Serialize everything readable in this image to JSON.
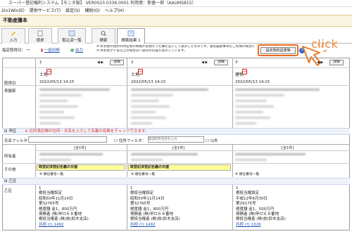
{
  "window": {
    "title": "スーパー登記権利システム【モニタ版】 VER0023.0336.0001 利用者：新香一郎（AAUMS815）"
  },
  "menu": [
    "2in1Win(E)",
    "提供サービス(T)",
    "設定(S)",
    "補助(O)",
    "ヘルプ(H)"
  ],
  "header": {
    "title": "不動産謄本"
  },
  "tabs": [
    {
      "label": "入力"
    },
    {
      "label": "請求"
    },
    {
      "label": "取込済一覧"
    },
    {
      "label": "検索"
    },
    {
      "label": "検索結果 1"
    }
  ],
  "toolbar": {
    "date_label": "指定取得日：",
    "date_sep": "〜",
    "print_link": "一括印刷",
    "export_link": "出力",
    "note1": "※ 所有者の住所の所在地の情報が必要だった欄を記入して請求したものです。通常履歴事項をご利用の場合に目印として使用されるものです。",
    "note2": "※ 共有者が５名以上の場合は一部分の内容を表示しています。",
    "settings_button": "設定契約証書等",
    "help_icon": "?"
  },
  "annotation": {
    "text": "click"
  },
  "columns": [
    {
      "num": "1",
      "detail": "詳細",
      "type": "土地",
      "date": "2022/05/13 14:15"
    },
    {
      "num": "2",
      "detail": "詳細",
      "type": "土地",
      "date": "2022/05/13 14:15"
    },
    {
      "num": "3",
      "detail": "詳細",
      "type": "建物",
      "date": "2022/05/13 14:15"
    }
  ],
  "rows": {
    "acquired": "取得日",
    "header_section": "表題部",
    "a_section": "甲区",
    "b_section": "乙区",
    "owner": "所有者",
    "other": "その他"
  },
  "kouku": {
    "note": "※ 住所表記欄の住所・氏名を入力して名義の有無をチェックできます。",
    "name_filter": "氏名フィルタ：",
    "addr_filter": "住所フィルタ：",
    "addr_placeholder": "都道府県名等を入力",
    "exclude": "以外",
    "share": "[全1件]"
  },
  "registration": {
    "label": "既登記済登記名義の日値",
    "sub": "※ 順位番号一覧"
  },
  "otsu": [
    {
      "num": "1",
      "lines": [
        "根抵当権設定",
        "昭和50年11月14日",
        "第32765号",
        "極度額 金1，800万円",
        "債務者 (株)甲ロ６８番地",
        "根抵当権者 (株)技(鈴木支店)"
      ],
      "link": "共担 (ｲ) 1492"
    },
    {
      "num": "1",
      "lines": [
        "根抵当権設定",
        "昭和50年11月14日",
        "第32765号",
        "極度額 金1，800万円",
        "債務者 (株)甲ロ６８番地",
        "根抵当権者 (株)技(鈴木支店)"
      ],
      "link": "共担 (ｲ) 1492"
    },
    {
      "num": "1",
      "lines": [
        "根抵当権設定",
        "平成12年6月30日",
        "第29175号",
        "極度額 金1，500万円",
        "債務者 (株)甲ロ６８番地",
        "根抵当権者 (株)技(鈴木支店)"
      ],
      "link": "共担 (ｲ) 1326"
    }
  ]
}
